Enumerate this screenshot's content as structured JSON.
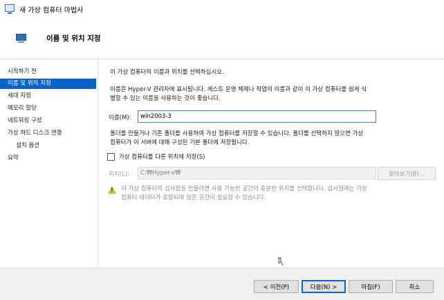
{
  "window": {
    "title": "새 가상 컴퓨터 마법사"
  },
  "header": {
    "title": "이름 및 위치 지정"
  },
  "sidebar": {
    "items": [
      {
        "label": "시작하기 전"
      },
      {
        "label": "이름 및 위치 지정"
      },
      {
        "label": "세대 지정"
      },
      {
        "label": "메모리 할당"
      },
      {
        "label": "네트워킹 구성"
      },
      {
        "label": "가상 하드 디스크 연결"
      },
      {
        "label": "설치 옵션"
      },
      {
        "label": "요약"
      }
    ]
  },
  "main": {
    "intro": "이 가상 컴퓨터의 이름과 위치를 선택하십시오.",
    "desc_line1": "이름은 Hyper-V 관리자에 표시됩니다. 게스트 운영 체제나 작업의 이름과 같이 이 가상 컴퓨터를 쉽게 식",
    "desc_line2": "별할 수 있는 이름을 사용하는 것이 좋습니다.",
    "name_label": "이름(M):",
    "name_value": "win2003-3",
    "folder_line1": "폴더를 만들거나 기존 폴더를 사용하여 가상 컴퓨터를 저장할 수 있습니다. 폴더를 선택하지 않으면 가상",
    "folder_line2": "컴퓨터가 이 서버에 대해 구성된 기본 폴더에 저장됩니다.",
    "checkbox_label": "가상 컴퓨터를 다른 위치에 저장(S)",
    "location_label": "위치(L):",
    "location_value": "C:₩Hyper-v₩",
    "browse_label": "찾아보기(B)...",
    "warning_line1": "이 가상 컴퓨터의 검사점을 만들려면 사용 가능한 공간이 충분한 위치를 선택합니다. 검사점에는 가상",
    "warning_line2": "컴퓨터 데이터가 포함되며 많은 공간이 필요할 수 있습니다."
  },
  "footer": {
    "prev_label": "< 이전(P)",
    "next_label": "다음(N) >",
    "finish_label": "마침(F)",
    "cancel_label": "취소"
  },
  "colors": {
    "accent": "#0a64c8",
    "warning": "#e8b21e"
  },
  "icons": {
    "app": "vm-icon",
    "header": "vm-icon",
    "warning": "warning-icon",
    "cursor": "mouse-cursor"
  }
}
